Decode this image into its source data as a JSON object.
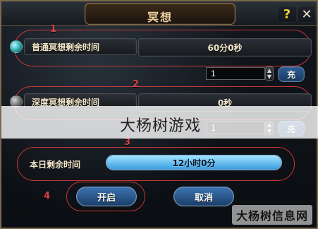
{
  "window": {
    "title": "冥想",
    "help_symbol": "?",
    "close_symbol": "✕"
  },
  "annotations": {
    "n1": "1",
    "n2": "2",
    "n3": "3",
    "n4": "4",
    "color": "#d44444"
  },
  "normal_meditation": {
    "label": "普通冥想剩余时间",
    "value": "60分0秒",
    "icon": "gem-icon",
    "input_value": "1",
    "charge_button": "充"
  },
  "deep_meditation": {
    "label": "深度冥想剩余时间",
    "value": "0秒",
    "icon": "shield-icon",
    "input_value": "1",
    "charge_button": "充"
  },
  "daily": {
    "label": "本日剩余时间",
    "value": "12小时0分",
    "fill_percent": 100
  },
  "buttons": {
    "start": "开启",
    "cancel": "取消"
  },
  "overlay": {
    "caption": "大杨树游戏",
    "watermark": "大杨树信息网"
  }
}
